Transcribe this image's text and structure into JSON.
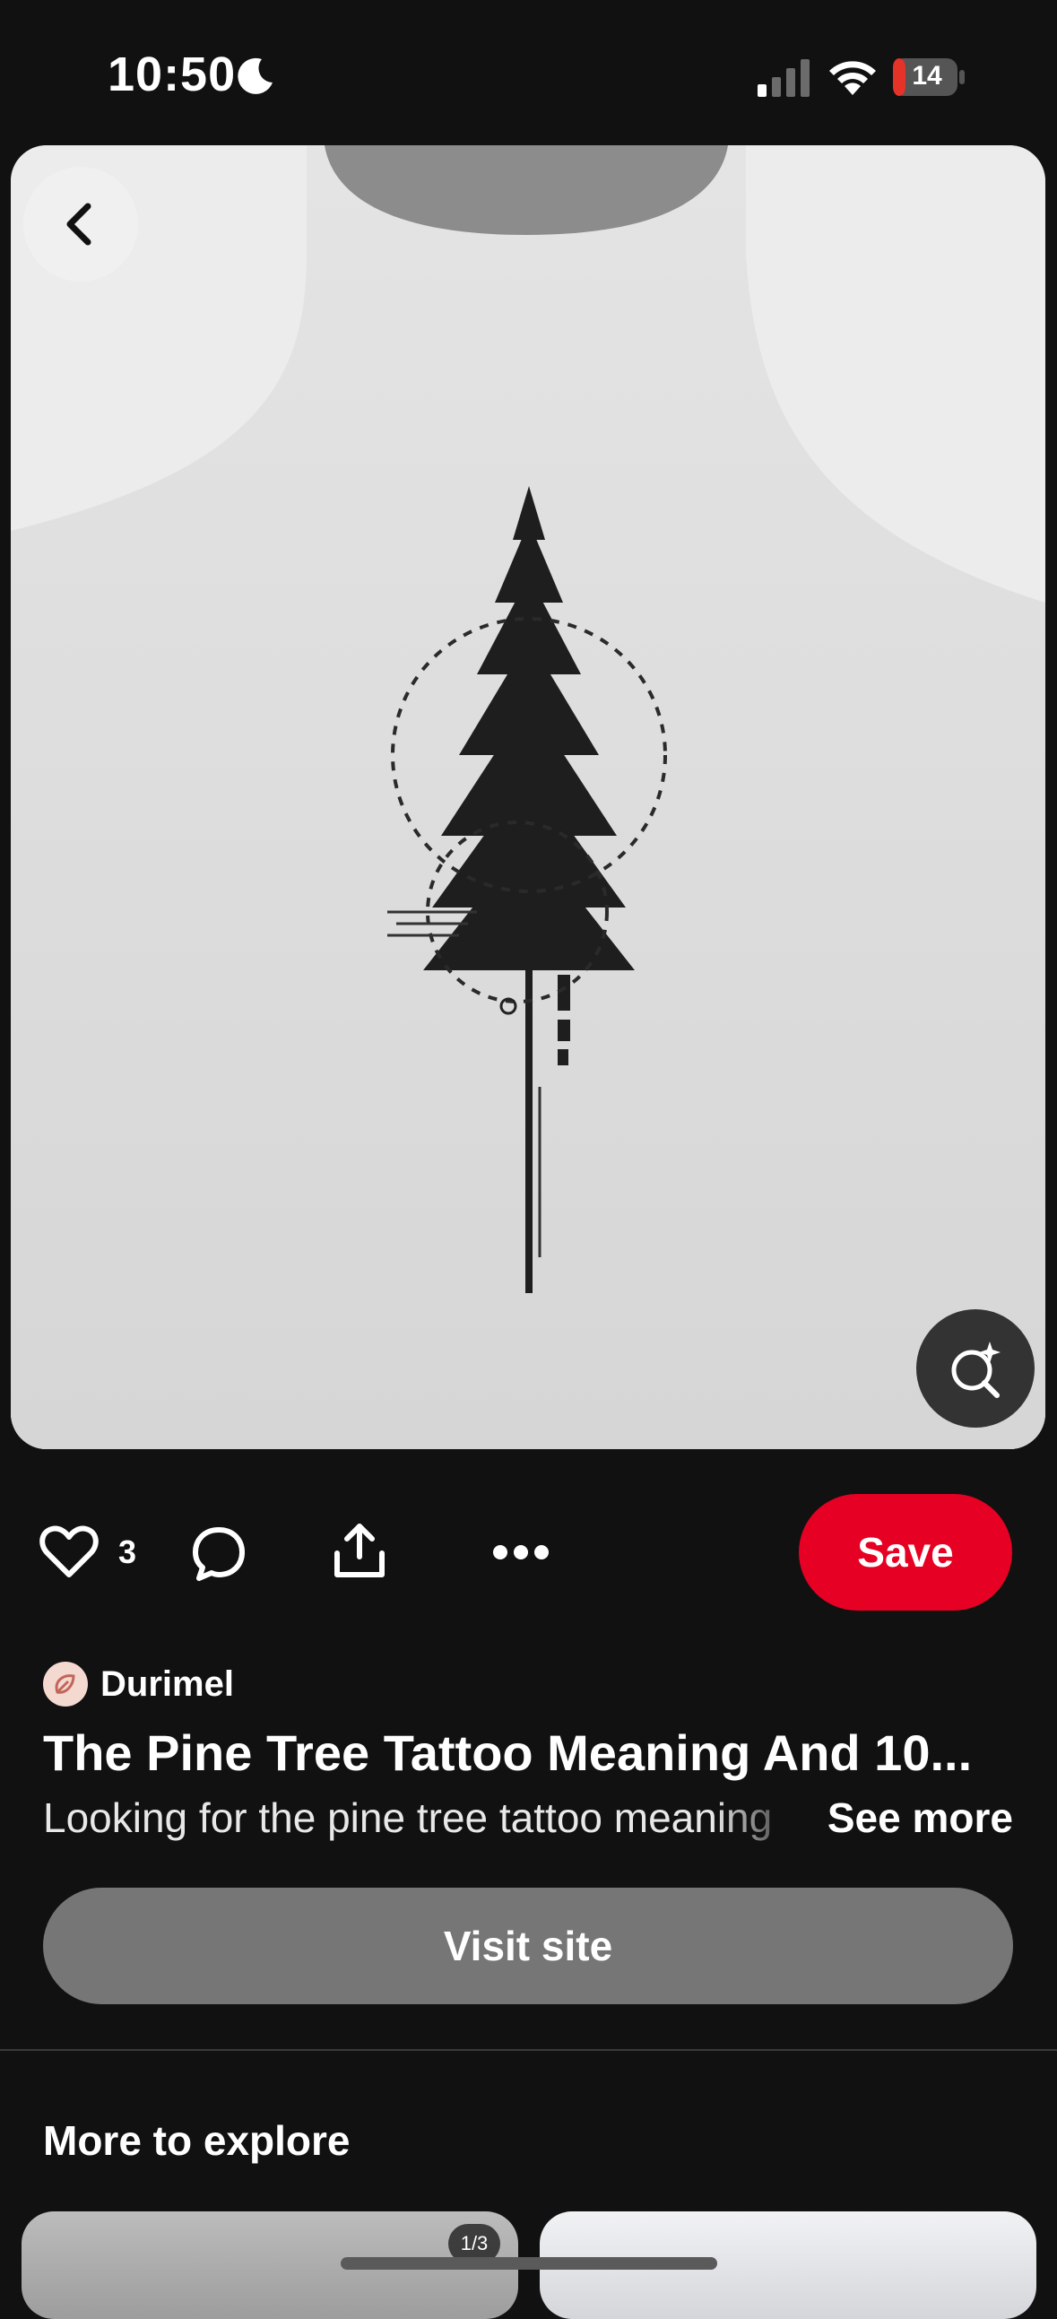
{
  "status_bar": {
    "time": "10:50",
    "battery": "14",
    "icons": [
      "moon-icon",
      "cellular-signal-icon",
      "wifi-icon",
      "battery-charging-icon"
    ]
  },
  "pin": {
    "image_subject": "pine-tree-back-tattoo",
    "like_count": "3",
    "save_label": "Save",
    "creator": "Durimel",
    "title": "The Pine Tree Tattoo Meaning And 10...",
    "description": "Looking for the pine tree tattoo meaning",
    "see_more_label": "See more",
    "visit_site_label": "Visit site"
  },
  "more_to_explore": {
    "title": "More to explore",
    "page_indicator": "1/3"
  },
  "colors": {
    "background": "#111111",
    "save_red": "#e60023",
    "visit_gray": "#767676"
  }
}
